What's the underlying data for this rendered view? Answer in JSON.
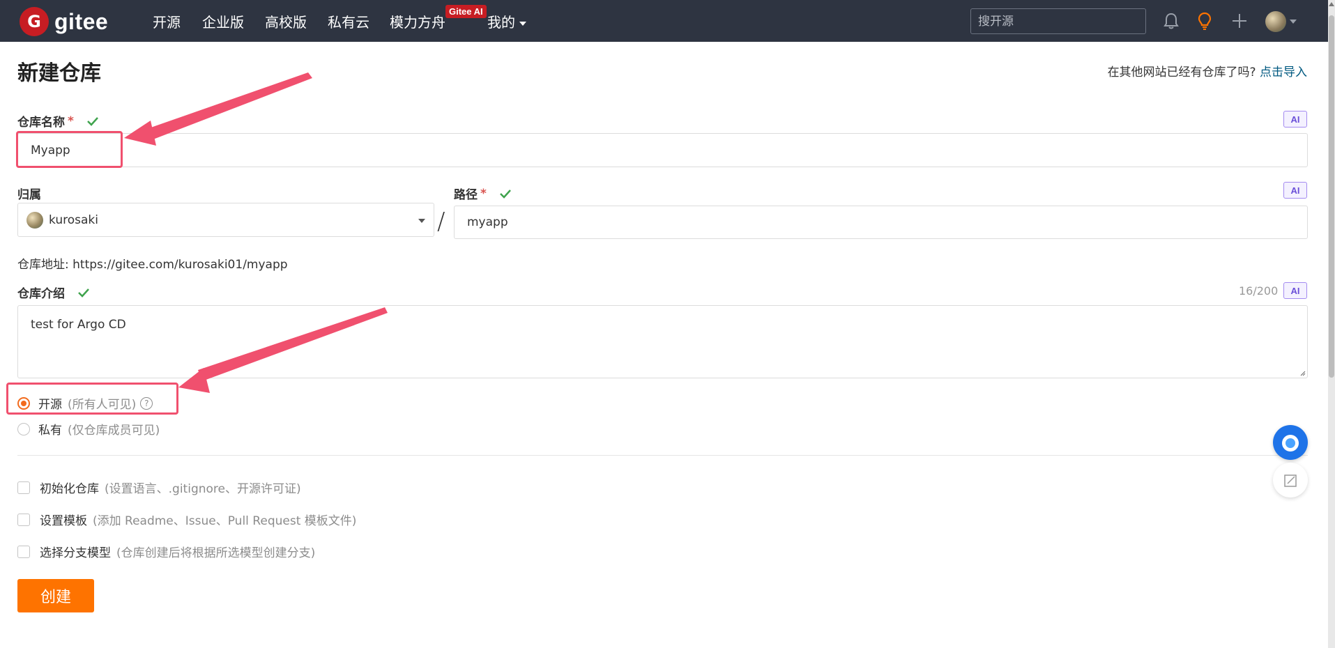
{
  "nav": {
    "logo_text": "gitee",
    "items": [
      "开源",
      "企业版",
      "高校版",
      "私有云",
      "模力方舟",
      "我的"
    ],
    "ai_badge": "Gitee AI",
    "search_placeholder": "搜开源"
  },
  "header": {
    "title": "新建仓库",
    "import_prompt": "在其他网站已经有仓库了吗?",
    "import_link": "点击导入"
  },
  "form": {
    "name_label": "仓库名称",
    "required_mark": "*",
    "name_value": "Myapp",
    "ai_label": "AI",
    "owner_label": "归属",
    "owner_value": "kurosaki",
    "separator": "/",
    "path_label": "路径",
    "path_value": "myapp",
    "repo_url": "仓库地址: https://gitee.com/kurosaki01/myapp",
    "desc_label": "仓库介绍",
    "desc_counter": "16/200",
    "desc_value": "test for Argo CD"
  },
  "visibility": {
    "options": [
      {
        "label": "开源",
        "hint": "(所有人可见)",
        "checked": true
      },
      {
        "label": "私有",
        "hint": "(仅仓库成员可见)",
        "checked": false
      }
    ],
    "help_glyph": "?"
  },
  "options": [
    {
      "label": "初始化仓库",
      "hint": "(设置语言、.gitignore、开源许可证)"
    },
    {
      "label": "设置模板",
      "hint": "(添加 Readme、Issue、Pull Request 模板文件)"
    },
    {
      "label": "选择分支模型",
      "hint": "(仓库创建后将根据所选模型创建分支)"
    }
  ],
  "submit_label": "创建",
  "colors": {
    "nav_bg": "#2e3441",
    "accent_orange": "#fe7300",
    "radio_orange": "#f26b1d",
    "highlight_pink": "#f0506e",
    "link_blue": "#005980",
    "check_green": "#3fa34d"
  },
  "icons": [
    "bell-icon",
    "lightbulb-icon",
    "plus-icon",
    "check-icon",
    "help-icon",
    "chat-icon",
    "feedback-icon"
  ]
}
